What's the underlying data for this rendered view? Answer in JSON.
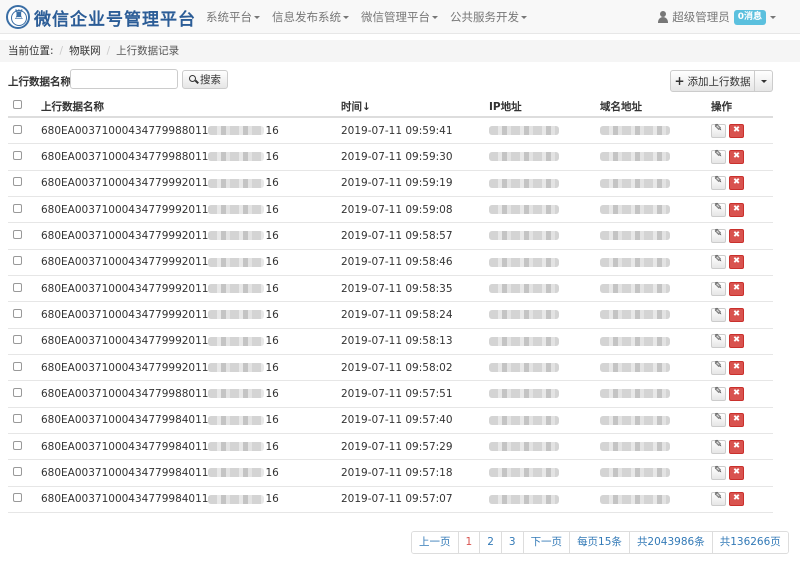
{
  "brand": {
    "title": "微信企业号管理平台"
  },
  "nav": {
    "items": [
      {
        "label": "系统平台"
      },
      {
        "label": "信息发布系统"
      },
      {
        "label": "微信管理平台"
      },
      {
        "label": "公共服务开发"
      }
    ]
  },
  "user": {
    "name": "超级管理员",
    "badge": "0消息"
  },
  "breadcrumb": {
    "prefix": "当前位置:",
    "sep": "/",
    "level1": "物联网",
    "current": "上行数据记录"
  },
  "search": {
    "label": "上行数据名称",
    "value": "",
    "placeholder": "",
    "button_label": "搜索"
  },
  "toolbar": {
    "add_label": "添加上行数据"
  },
  "table": {
    "headers": {
      "name": "上行数据名称",
      "time": "时间↓",
      "ip": "IP地址",
      "domain": "域名地址",
      "ops": "操作"
    },
    "rows": [
      {
        "name_prefix": "680EA00371000434779988011",
        "name_suffix": "16",
        "time": "2019-07-11 09:59:41"
      },
      {
        "name_prefix": "680EA00371000434779988011",
        "name_suffix": "16",
        "time": "2019-07-11 09:59:30"
      },
      {
        "name_prefix": "680EA00371000434779992011",
        "name_suffix": "16",
        "time": "2019-07-11 09:59:19"
      },
      {
        "name_prefix": "680EA00371000434779992011",
        "name_suffix": "16",
        "time": "2019-07-11 09:59:08"
      },
      {
        "name_prefix": "680EA00371000434779992011",
        "name_suffix": "16",
        "time": "2019-07-11 09:58:57"
      },
      {
        "name_prefix": "680EA00371000434779992011",
        "name_suffix": "16",
        "time": "2019-07-11 09:58:46"
      },
      {
        "name_prefix": "680EA00371000434779992011",
        "name_suffix": "16",
        "time": "2019-07-11 09:58:35"
      },
      {
        "name_prefix": "680EA00371000434779992011",
        "name_suffix": "16",
        "time": "2019-07-11 09:58:24"
      },
      {
        "name_prefix": "680EA00371000434779992011",
        "name_suffix": "16",
        "time": "2019-07-11 09:58:13"
      },
      {
        "name_prefix": "680EA00371000434779992011",
        "name_suffix": "16",
        "time": "2019-07-11 09:58:02"
      },
      {
        "name_prefix": "680EA00371000434779988011",
        "name_suffix": "16",
        "time": "2019-07-11 09:57:51"
      },
      {
        "name_prefix": "680EA00371000434779984011",
        "name_suffix": "16",
        "time": "2019-07-11 09:57:40"
      },
      {
        "name_prefix": "680EA00371000434779984011",
        "name_suffix": "16",
        "time": "2019-07-11 09:57:29"
      },
      {
        "name_prefix": "680EA00371000434779984011",
        "name_suffix": "16",
        "time": "2019-07-11 09:57:18"
      },
      {
        "name_prefix": "680EA00371000434779984011",
        "name_suffix": "16",
        "time": "2019-07-11 09:57:07"
      }
    ]
  },
  "pagination": {
    "prev": "上一页",
    "pages": [
      "1",
      "2",
      "3"
    ],
    "current_page": "1",
    "next": "下一页",
    "per_page": "每页15条",
    "total_records": "共2043986条",
    "total_pages": "共136266页"
  },
  "colors": {
    "brand": "#2c5d97",
    "danger": "#d9534f",
    "link": "#337ab7",
    "badge": "#5bc0de"
  },
  "icons": {
    "logo": "emblem-logo-icon",
    "user": "user-icon",
    "search": "search-icon",
    "add": "plus-icon",
    "edit": "edit-icon",
    "delete": "delete-icon"
  }
}
